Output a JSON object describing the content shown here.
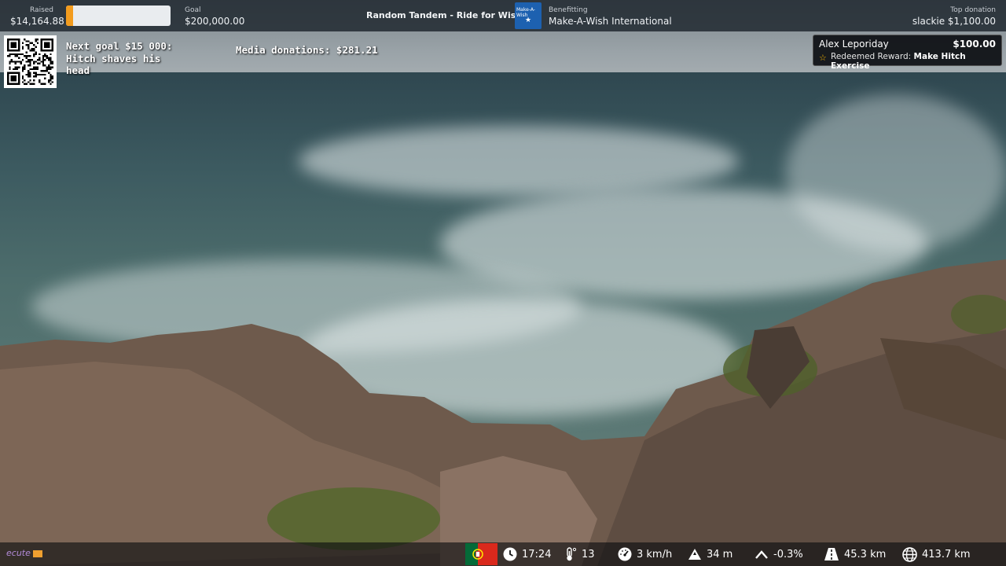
{
  "topbar": {
    "raised_label": "Raised",
    "raised_value": "$14,164.88",
    "progress_fraction": 0.07,
    "goal_label": "Goal",
    "goal_value": "$200,000.00",
    "stream_title": "Random Tandem - Ride for Wishes",
    "benefitting_label": "Benefitting",
    "benefitting_value": "Make-A-Wish International",
    "logo_text_top": "Make-A-Wish",
    "top_donation_label": "Top donation",
    "top_donation_value": "slackie $1,100.00"
  },
  "overlay": {
    "next_goal": "Next goal $15 000: Hitch shaves his head",
    "media_donations": "Media donations: $281.21"
  },
  "alert": {
    "user": "Alex Leporiday",
    "amount": "$100.00",
    "message_prefix": "Redeemed Reward:",
    "message_reward": "Make Hitch Exercise"
  },
  "bottombar": {
    "brand": "ecute",
    "time": "17:24",
    "temperature": "13",
    "speed": "3 km/h",
    "altitude": "34 m",
    "gradient": "-0.3%",
    "distance_ride": "45.3 km",
    "distance_total": "413.7 km"
  },
  "colors": {
    "progress_fill": "#f39c1e",
    "topbar_bg": "#1c242c",
    "alert_star": "#f5b400",
    "flag_green": "#046a38",
    "flag_red": "#da291c"
  }
}
